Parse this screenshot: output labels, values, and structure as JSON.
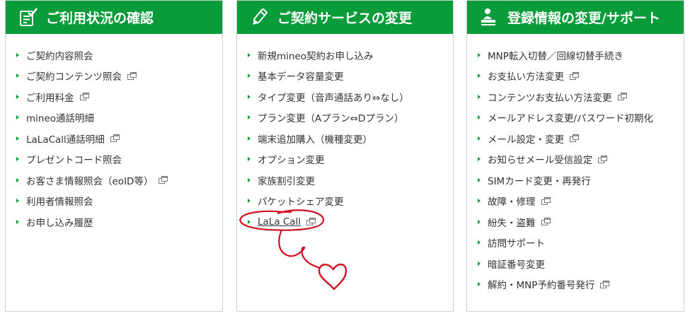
{
  "colors": {
    "header": "#0a9c3a",
    "bullet": "#0a9c3a",
    "annotation": "#d0101e",
    "text": "#333333"
  },
  "panels": [
    {
      "title": "ご利用状況の確認",
      "icon": "clipboard-check-icon",
      "items": [
        {
          "label": "ご契約内容照会",
          "external": false
        },
        {
          "label": "ご契約コンテンツ照会",
          "external": true
        },
        {
          "label": "ご利用料金",
          "external": true
        },
        {
          "label": "mineo通話明細",
          "external": false
        },
        {
          "label": "LaLaCall通話明細",
          "external": true
        },
        {
          "label": "プレゼントコード照会",
          "external": false
        },
        {
          "label": "お客さま情報照会（eoID等）",
          "external": true
        },
        {
          "label": "利用者情報照会",
          "external": false
        },
        {
          "label": "お申し込み履歴",
          "external": false
        }
      ]
    },
    {
      "title": "ご契約サービスの変更",
      "icon": "pencil-icon",
      "items": [
        {
          "label": "新規mineo契約お申し込み",
          "external": false
        },
        {
          "label": "基本データ容量変更",
          "external": false
        },
        {
          "label": "タイプ変更（音声通話あり⇔なし）",
          "external": false
        },
        {
          "label": "プラン変更（Aプラン⇔Dプラン）",
          "external": false
        },
        {
          "label": "端末追加購入（機種変更）",
          "external": false
        },
        {
          "label": "オプション変更",
          "external": false
        },
        {
          "label": "家族割引変更",
          "external": false
        },
        {
          "label": "パケットシェア変更",
          "external": false
        },
        {
          "label": "LaLa Call",
          "external": true,
          "highlighted": true
        }
      ]
    },
    {
      "title": "登録情報の変更/サポート",
      "icon": "person-desk-icon",
      "items": [
        {
          "label": "MNP転入切替／回線切替手続き",
          "external": false
        },
        {
          "label": "お支払い方法変更",
          "external": true
        },
        {
          "label": "コンテンツお支払い方法変更",
          "external": true
        },
        {
          "label": "メールアドレス変更/パスワード初期化",
          "external": false
        },
        {
          "label": "メール設定・変更",
          "external": true
        },
        {
          "label": "お知らせメール受信設定",
          "external": true
        },
        {
          "label": "SIMカード変更・再発行",
          "external": false
        },
        {
          "label": "故障・修理",
          "external": true
        },
        {
          "label": "紛失・盗難",
          "external": true
        },
        {
          "label": "訪問サポート",
          "external": false
        },
        {
          "label": "暗証番号変更",
          "external": false
        },
        {
          "label": "解約・MNP予約番号発行",
          "external": true
        }
      ]
    }
  ]
}
